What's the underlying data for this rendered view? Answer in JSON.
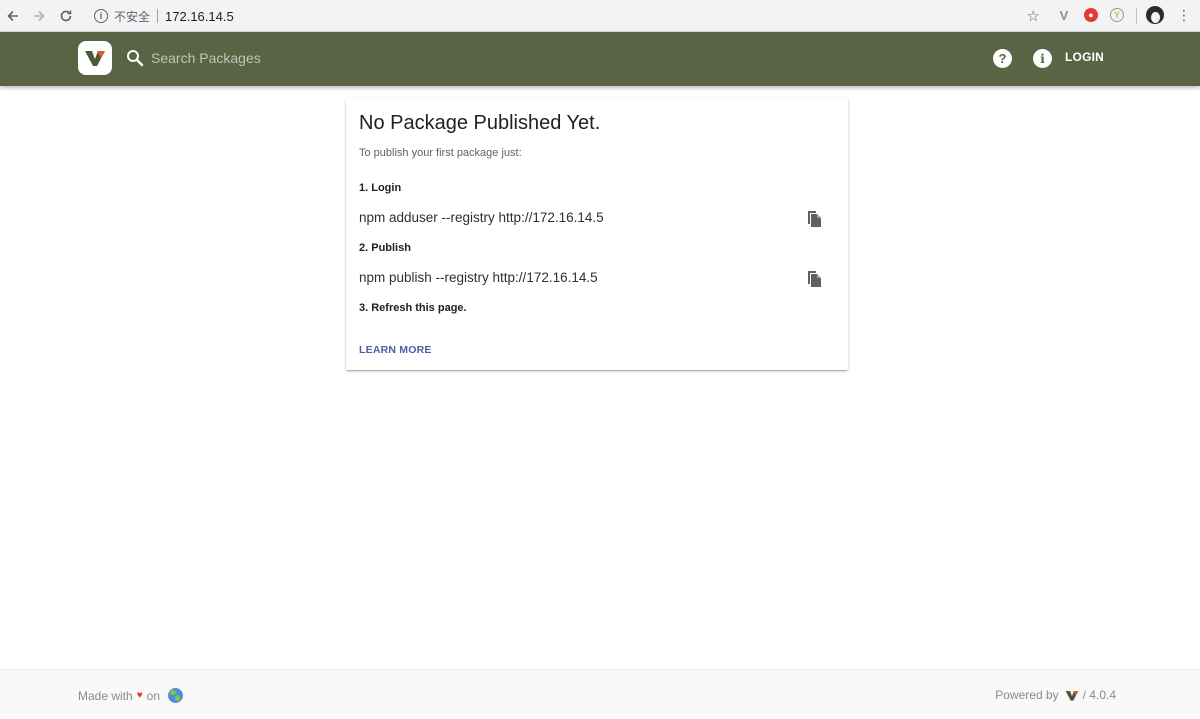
{
  "browser": {
    "insecure_label": "不安全",
    "url": "172.16.14.5",
    "kebab": "⋮",
    "star": "☆"
  },
  "header": {
    "search_placeholder": "Search Packages",
    "login_label": "LOGIN",
    "help_glyph": "?",
    "info_glyph": "i",
    "brand_color": "#586444"
  },
  "card": {
    "title": "No Package Published Yet.",
    "subtitle": "To publish your first package just:",
    "steps": [
      {
        "label": "1. Login",
        "command": "npm adduser --registry http://172.16.14.5"
      },
      {
        "label": "2. Publish",
        "command": "npm publish --registry http://172.16.14.5"
      },
      {
        "label": "3. Refresh this page."
      }
    ],
    "learn_more": "LEARN MORE",
    "link_color": "#4b5fa5"
  },
  "footer": {
    "made_with": "Made with",
    "on": "on",
    "heart": "♥",
    "powered_by": "Powered by",
    "version": "/ 4.0.4"
  },
  "icons": {
    "back": "back-arrow-icon",
    "forward": "forward-arrow-icon",
    "reload": "reload-icon",
    "search": "search-icon",
    "help": "help-icon",
    "info": "info-icon",
    "copy": "copy-icon",
    "heart": "heart-icon",
    "globe": "globe-icon",
    "logo": "verdaccio-logo-icon"
  }
}
